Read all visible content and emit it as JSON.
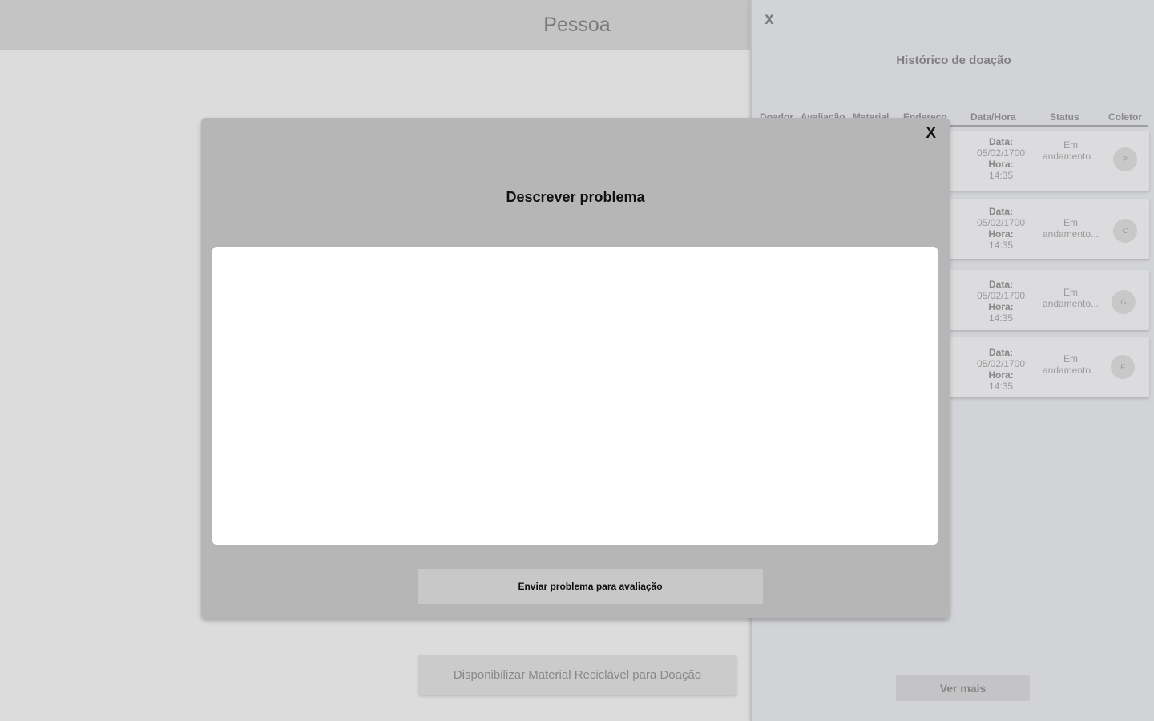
{
  "page": {
    "title": "Pessoa",
    "donate_button": "Disponibilizar Material Reciclável para Doação"
  },
  "history": {
    "close_label": "x",
    "title": "Histórico de doação",
    "columns": [
      "Doador",
      "Avaliação",
      "Material",
      "Endereço",
      "Data/Hora",
      "Status",
      "Coletor"
    ],
    "date_label": "Data:",
    "time_label": "Hora:",
    "rows": [
      {
        "date": "05/02/1700",
        "time": "14:35",
        "status": "Em andamento...",
        "collector_initial": "P"
      },
      {
        "date": "05/02/1700",
        "time": "14:35",
        "status": "Em andamento...",
        "collector_initial": "C"
      },
      {
        "date": "05/02/1700",
        "time": "14:35",
        "status": "Em andamento...",
        "collector_initial": "G"
      },
      {
        "date": "05/02/1700",
        "time": "14:35",
        "status": "Em andamento...",
        "collector_initial": "F"
      }
    ],
    "more_button": "Ver mais"
  },
  "modal": {
    "close_label": "X",
    "title": "Descrever problema",
    "textarea_value": "",
    "submit_button": "Enviar problema para avaliação"
  }
}
